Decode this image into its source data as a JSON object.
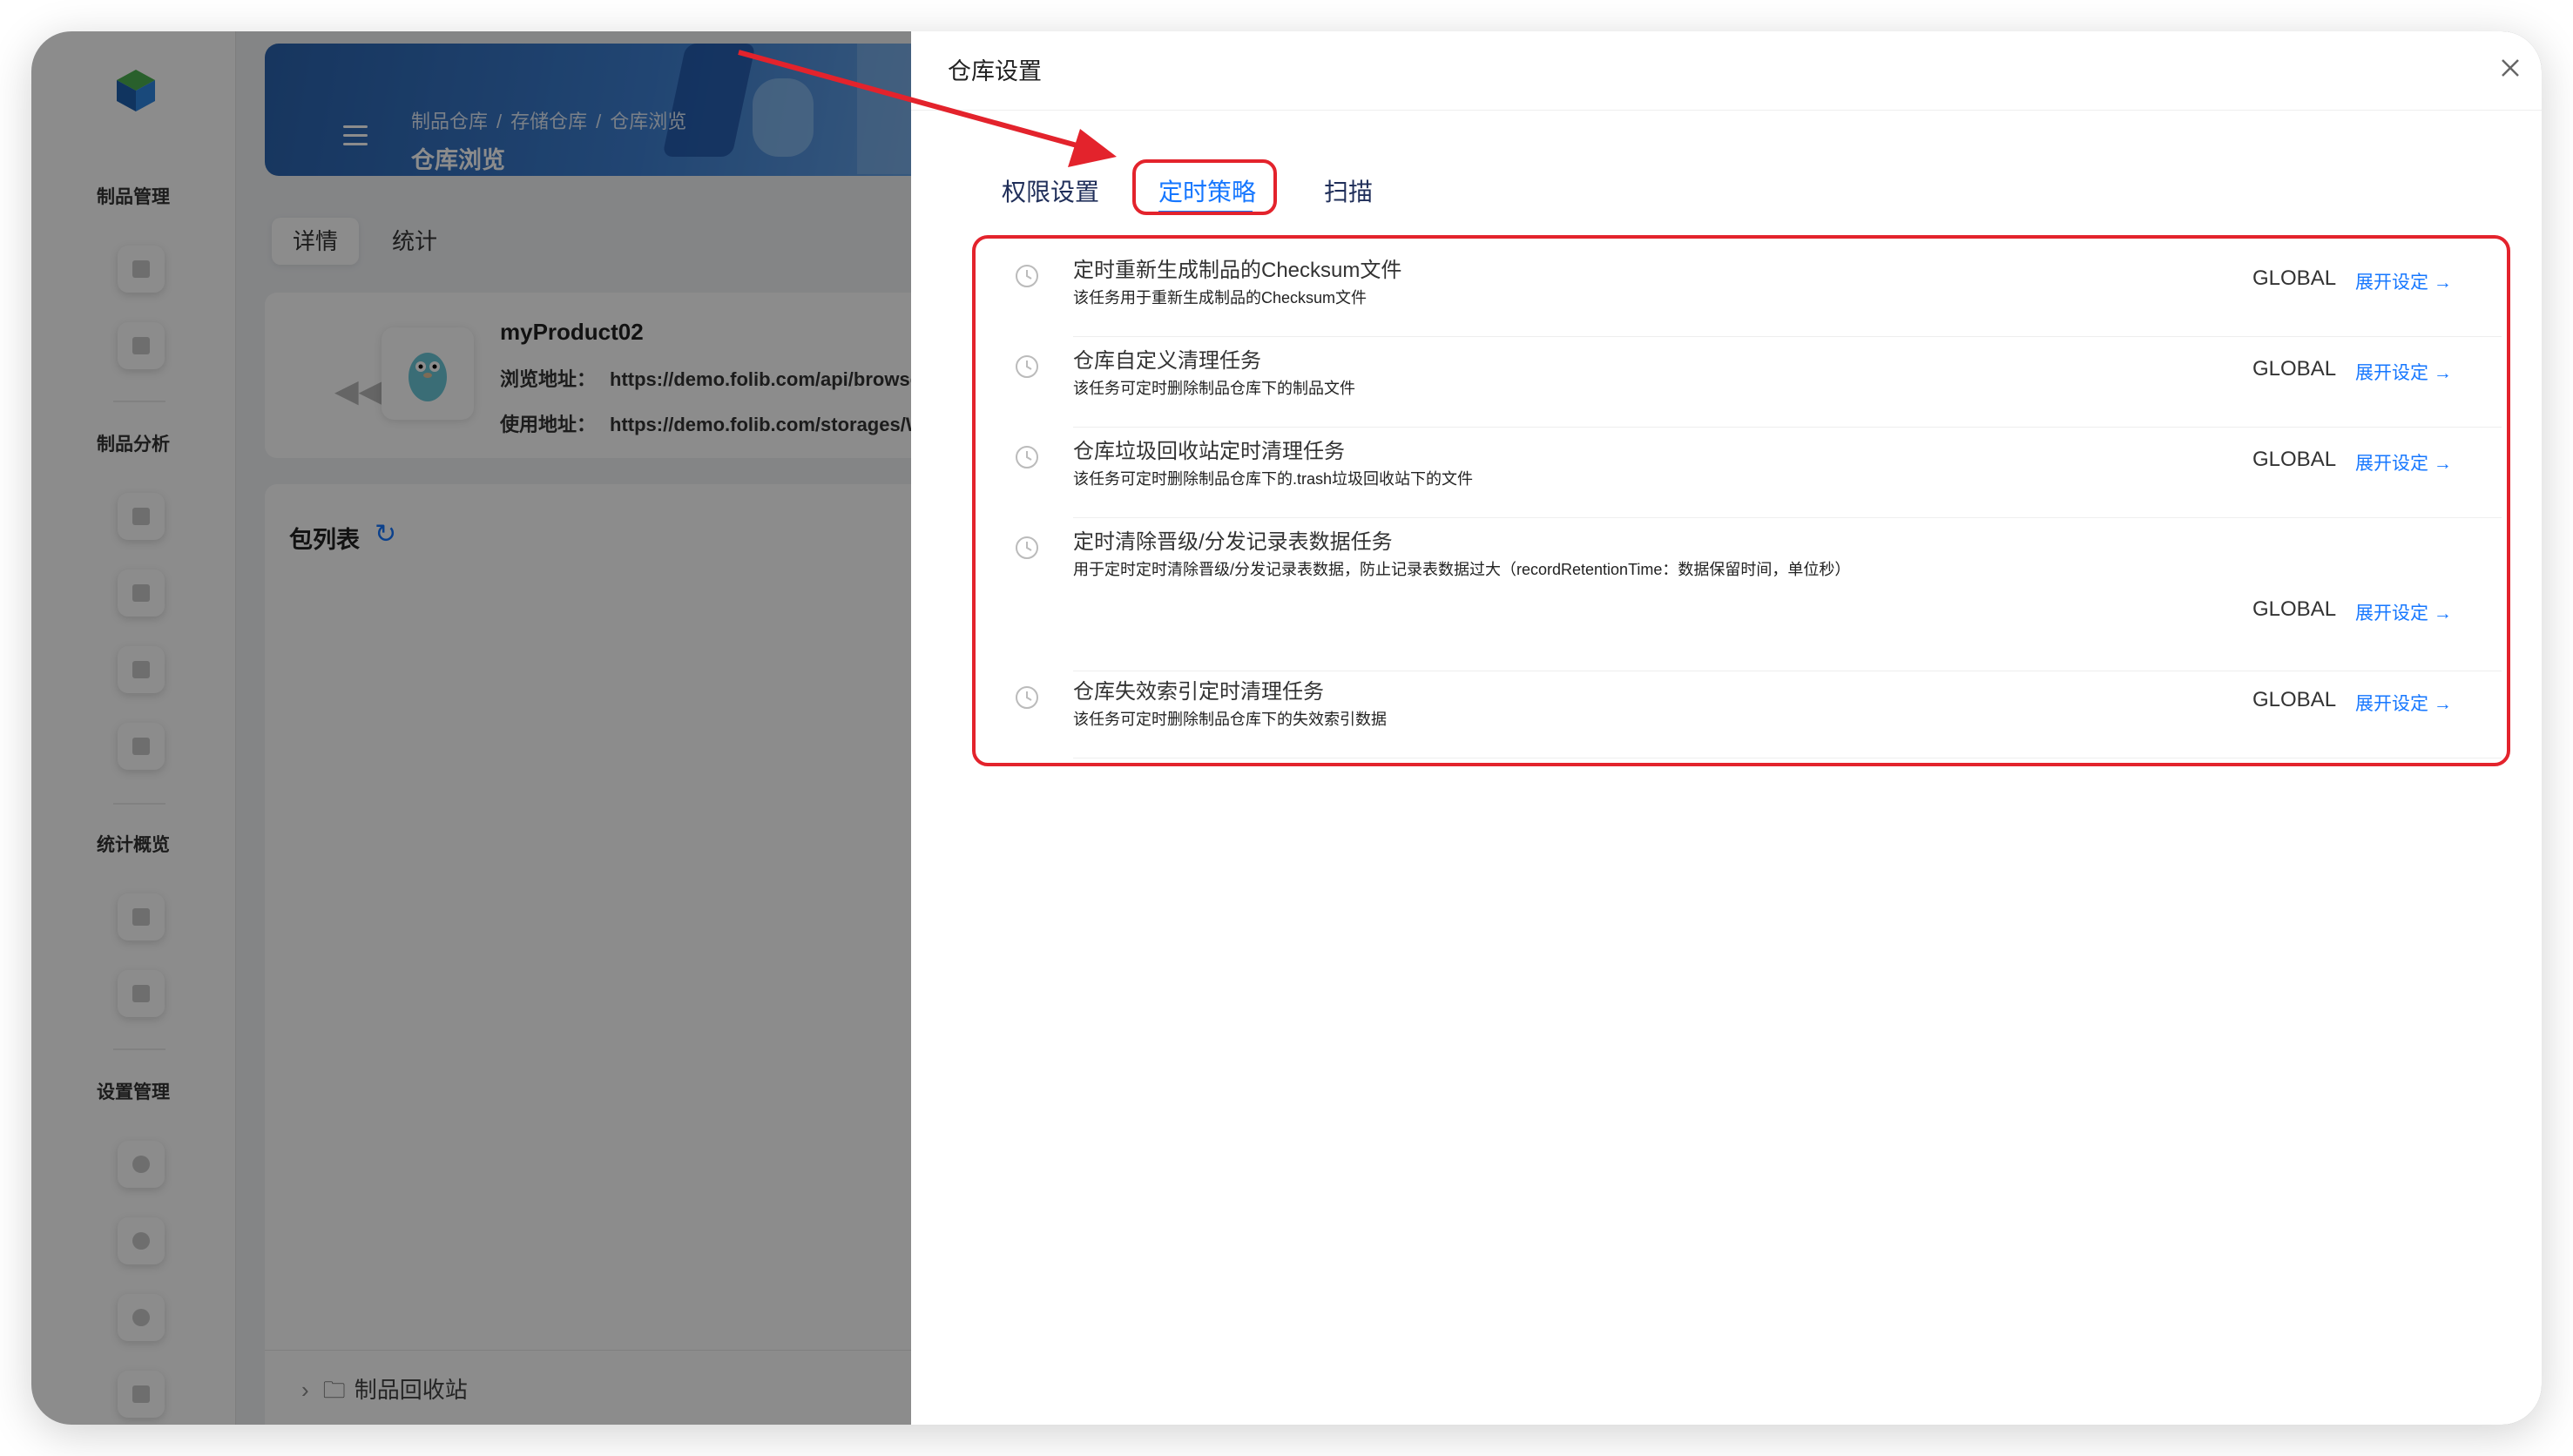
{
  "sidebar": {
    "sections": [
      {
        "title": "制品管理",
        "items": [
          "dashboard-icon",
          "card-icon"
        ]
      },
      {
        "title": "制品分析",
        "items": [
          "report-icon",
          "list-icon",
          "bug-icon",
          "file-icon"
        ]
      },
      {
        "title": "统计概览",
        "items": [
          "user-icon",
          "grid-icon"
        ]
      },
      {
        "title": "设置管理",
        "items": [
          "settings-icon",
          "user-circle-icon",
          "sync-icon",
          "lock-icon"
        ]
      }
    ]
  },
  "page": {
    "breadcrumb": [
      "制品仓库",
      "存储仓库",
      "仓库浏览"
    ],
    "title": "仓库浏览",
    "tabs": [
      "详情",
      "统计"
    ],
    "product": {
      "name": "myProduct02",
      "browse_label": "浏览地址：",
      "browse_url": "https://demo.folib.com/api/browse/W",
      "use_label": "使用地址：",
      "use_url": "https://demo.folib.com/storages/Wa"
    },
    "package_list_title": "包列表",
    "recycle_bin": "制品回收站"
  },
  "drawer": {
    "title": "仓库设置",
    "tabs": [
      "权限设置",
      "定时策略",
      "扫描"
    ],
    "active_tab": "定时策略",
    "policies": [
      {
        "title": "定时重新生成制品的Checksum文件",
        "desc": "该任务用于重新生成制品的Checksum文件",
        "scope": "GLOBAL",
        "action": "展开设定"
      },
      {
        "title": "仓库自定义清理任务",
        "desc": "该任务可定时删除制品仓库下的制品文件",
        "scope": "GLOBAL",
        "action": "展开设定"
      },
      {
        "title": "仓库垃圾回收站定时清理任务",
        "desc": "该任务可定时删除制品仓库下的.trash垃圾回收站下的文件",
        "scope": "GLOBAL",
        "action": "展开设定"
      },
      {
        "title": "定时清除晋级/分发记录表数据任务",
        "desc": "用于定时定时清除晋级/分发记录表数据，防止记录表数据过大（recordRetentionTime：数据保留时间，单位秒）",
        "scope": "GLOBAL",
        "action": "展开设定"
      },
      {
        "title": "仓库失效索引定时清理任务",
        "desc": "该任务可定时删除制品仓库下的失效索引数据",
        "scope": "GLOBAL",
        "action": "展开设定"
      }
    ]
  },
  "colors": {
    "accent": "#1677ff",
    "annotation": "#e3232c"
  }
}
